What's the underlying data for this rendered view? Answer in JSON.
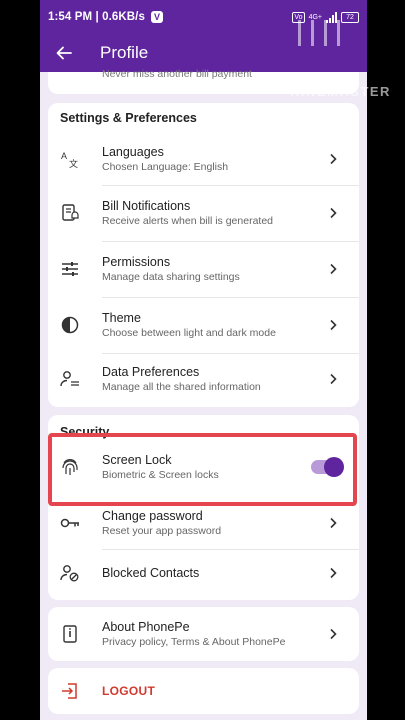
{
  "status_bar": {
    "time": "1:54 PM | 0.6KB/s",
    "net_badge": "Vo",
    "network": "4G+",
    "battery": "72"
  },
  "app_bar": {
    "title": "Profile"
  },
  "watermark": "KINEMASTER",
  "top_card": {
    "clipped_text": "Never miss another bill payment"
  },
  "settings": {
    "title": "Settings & Preferences",
    "items": [
      {
        "title": "Languages",
        "subtitle": "Chosen Language: English"
      },
      {
        "title": "Bill Notifications",
        "subtitle": "Receive alerts when bill is generated"
      },
      {
        "title": "Permissions",
        "subtitle": "Manage data sharing settings"
      },
      {
        "title": "Theme",
        "subtitle": "Choose between light and dark mode"
      },
      {
        "title": "Data Preferences",
        "subtitle": "Manage all the shared information"
      }
    ]
  },
  "security": {
    "title": "Security",
    "screen_lock": {
      "title": "Screen Lock",
      "subtitle": "Biometric & Screen locks",
      "enabled": true
    },
    "change_password": {
      "title": "Change password",
      "subtitle": "Reset your app password"
    },
    "blocked": {
      "title": "Blocked Contacts"
    }
  },
  "about": {
    "title": "About PhonePe",
    "subtitle": "Privacy policy, Terms & About PhonePe"
  },
  "logout": {
    "label": "LOGOUT"
  },
  "colors": {
    "brand": "#5f259f",
    "highlight": "#e5454f",
    "logout": "#d03a2f"
  }
}
